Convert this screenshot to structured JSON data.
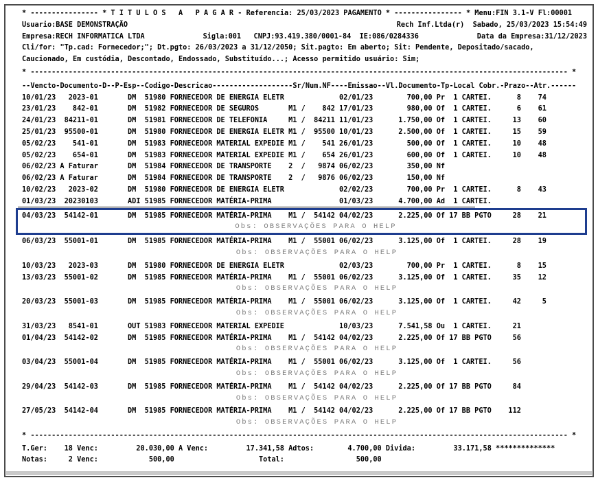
{
  "colors": {
    "selection_box_border": "#1e3d8f",
    "observation_text": "#7d7d7d",
    "window_border": "#4b4b4b",
    "bottom_strip": "#c9c9c9"
  },
  "header": {
    "title_line": "* ---------------- * T I T U L O S   A   P A G A R - Referencia: 25/03/2023 PAGAMENTO * ---------------- * Menu:FIN 3.1-V Fl:00001",
    "usuario": "Usuario:BASE DEMONSTRAÇÃO",
    "vendor_datetime": "Rech Inf.Ltda(r)  Sabado, 25/03/2023 15:54:49",
    "empresa": "Empresa:RECH INFORMATICA LTDA",
    "sigla_cnpj_ie": "Sigla:001   CNPJ:93.419.380/0001-84  IE:086/0284336",
    "data_empresa": "Data da Empresa:31/12/2023",
    "filter_line1": "Cli/for: \"Tp.cad: Fornecedor;\"; Dt.pgto: 26/03/2023 a 31/12/2050; Sit.pagto: Em aberto; Sit: Pendente, Depositado/sacado,",
    "filter_line2": "Caucionado, Em custódia, Descontado, Endossado, Substituído...; Acesso permitido usuário: Sim;"
  },
  "separator_line": "* ------------------------------------------------------------------------------------------------------------------------------- *",
  "columns_header": "--Vencto-Documento-D--P-Esp--Codigo-Descricao-------------------Sr/Num.NF----Emissao--Vl.Documento-Tp-Local Cobr.-Prazo--Atr.------",
  "rows": [
    {
      "vencto": "10/01/23",
      "documento": "2023-01",
      "esp": "DM",
      "codigo": "51980",
      "descricao": "FORNECEDOR DE ENERGIA ELETR",
      "sr": "",
      "num_nf": "",
      "emissao": "02/01/23",
      "valor": "700,00",
      "tp": "Pr",
      "local_num": "1",
      "local_name": "CARTEI.",
      "prazo": "8",
      "atr": "74",
      "obs": "",
      "row_class": ""
    },
    {
      "vencto": "23/01/23",
      "documento": "842-01",
      "esp": "DM",
      "codigo": "51982",
      "descricao": "FORNECEDOR DE SEGUROS",
      "sr": "M1 /",
      "num_nf": "842",
      "emissao": "17/01/23",
      "valor": "980,00",
      "tp": "Of",
      "local_num": "1",
      "local_name": "CARTEI.",
      "prazo": "6",
      "atr": "61",
      "obs": "",
      "row_class": ""
    },
    {
      "vencto": "24/01/23",
      "documento": "84211-01",
      "esp": "DM",
      "codigo": "51981",
      "descricao": "FORNECEDOR DE TELEFONIA",
      "sr": "M1 /",
      "num_nf": "84211",
      "emissao": "11/01/23",
      "valor": "1.750,00",
      "tp": "Of",
      "local_num": "1",
      "local_name": "CARTEI.",
      "prazo": "13",
      "atr": "60",
      "obs": "",
      "row_class": ""
    },
    {
      "vencto": "25/01/23",
      "documento": "95500-01",
      "esp": "DM",
      "codigo": "51980",
      "descricao": "FORNECEDOR DE ENERGIA ELETR",
      "sr": "M1 /",
      "num_nf": "95500",
      "emissao": "10/01/23",
      "valor": "2.500,00",
      "tp": "Of",
      "local_num": "1",
      "local_name": "CARTEI.",
      "prazo": "15",
      "atr": "59",
      "obs": "",
      "row_class": ""
    },
    {
      "vencto": "05/02/23",
      "documento": "541-01",
      "esp": "DM",
      "codigo": "51983",
      "descricao": "FORNECEDOR MATERIAL EXPEDIE",
      "sr": "M1 /",
      "num_nf": "541",
      "emissao": "26/01/23",
      "valor": "500,00",
      "tp": "Of",
      "local_num": "1",
      "local_name": "CARTEI.",
      "prazo": "10",
      "atr": "48",
      "obs": "",
      "row_class": ""
    },
    {
      "vencto": "05/02/23",
      "documento": "654-01",
      "esp": "DM",
      "codigo": "51983",
      "descricao": "FORNECEDOR MATERIAL EXPEDIE",
      "sr": "M1 /",
      "num_nf": "654",
      "emissao": "26/01/23",
      "valor": "600,00",
      "tp": "Of",
      "local_num": "1",
      "local_name": "CARTEI.",
      "prazo": "10",
      "atr": "48",
      "obs": "",
      "row_class": ""
    },
    {
      "vencto": "06/02/23",
      "documento": "A Faturar",
      "esp": "DM",
      "codigo": "51984",
      "descricao": "FORNECEDOR DE TRANSPORTE",
      "sr": "2  /",
      "num_nf": "9874",
      "emissao": "06/02/23",
      "valor": "350,00",
      "tp": "Nf",
      "local_num": "",
      "local_name": "",
      "prazo": "",
      "atr": "",
      "obs": "",
      "row_class": ""
    },
    {
      "vencto": "06/02/23",
      "documento": "A Faturar",
      "esp": "DM",
      "codigo": "51984",
      "descricao": "FORNECEDOR DE TRANSPORTE",
      "sr": "2  /",
      "num_nf": "9876",
      "emissao": "06/02/23",
      "valor": "150,00",
      "tp": "Nf",
      "local_num": "",
      "local_name": "",
      "prazo": "",
      "atr": "",
      "obs": "",
      "row_class": ""
    },
    {
      "vencto": "10/02/23",
      "documento": "2023-02",
      "esp": "DM",
      "codigo": "51980",
      "descricao": "FORNECEDOR DE ENERGIA ELETR",
      "sr": "",
      "num_nf": "",
      "emissao": "02/02/23",
      "valor": "700,00",
      "tp": "Pr",
      "local_num": "1",
      "local_name": "CARTEI.",
      "prazo": "8",
      "atr": "43",
      "obs": "",
      "row_class": ""
    },
    {
      "vencto": "01/03/23",
      "documento": "20230103",
      "esp": "ADI",
      "codigo": "51985",
      "descricao": "FORNECEDOR MATÉRIA-PRIMA",
      "sr": "",
      "num_nf": "",
      "emissao": "01/03/23",
      "valor": "4.700,00",
      "tp": "Ad",
      "local_num": "1",
      "local_name": "CARTEI.",
      "prazo": "",
      "atr": "",
      "obs": "",
      "row_class": "underlined"
    },
    {
      "vencto": "04/03/23",
      "documento": "54142-01",
      "esp": "DM",
      "codigo": "51985",
      "descricao": "FORNECEDOR MATÉRIA-PRIMA",
      "sr": "M1 /",
      "num_nf": "54142",
      "emissao": "04/02/23",
      "valor": "2.225,00",
      "tp": "Of",
      "local_num": "17",
      "local_name": "BB PGTO",
      "prazo": "28",
      "atr": "21",
      "obs": "Obs: OBSERVAÇÕES PARA O HELP",
      "row_class": "selected"
    },
    {
      "vencto": "06/03/23",
      "documento": "55001-01",
      "esp": "DM",
      "codigo": "51985",
      "descricao": "FORNECEDOR MATÉRIA-PRIMA",
      "sr": "M1 /",
      "num_nf": "55001",
      "emissao": "06/02/23",
      "valor": "3.125,00",
      "tp": "Of",
      "local_num": "1",
      "local_name": "CARTEI.",
      "prazo": "28",
      "atr": "19",
      "obs": "Obs: OBSERVAÇÕES PARA O HELP",
      "row_class": ""
    },
    {
      "vencto": "10/03/23",
      "documento": "2023-03",
      "esp": "DM",
      "codigo": "51980",
      "descricao": "FORNECEDOR DE ENERGIA ELETR",
      "sr": "",
      "num_nf": "",
      "emissao": "02/03/23",
      "valor": "700,00",
      "tp": "Pr",
      "local_num": "1",
      "local_name": "CARTEI.",
      "prazo": "8",
      "atr": "15",
      "obs": "",
      "row_class": ""
    },
    {
      "vencto": "13/03/23",
      "documento": "55001-02",
      "esp": "DM",
      "codigo": "51985",
      "descricao": "FORNECEDOR MATÉRIA-PRIMA",
      "sr": "M1 /",
      "num_nf": "55001",
      "emissao": "06/02/23",
      "valor": "3.125,00",
      "tp": "Of",
      "local_num": "1",
      "local_name": "CARTEI.",
      "prazo": "35",
      "atr": "12",
      "obs": "Obs: OBSERVAÇÕES PARA O HELP",
      "row_class": ""
    },
    {
      "vencto": "20/03/23",
      "documento": "55001-03",
      "esp": "DM",
      "codigo": "51985",
      "descricao": "FORNECEDOR MATÉRIA-PRIMA",
      "sr": "M1 /",
      "num_nf": "55001",
      "emissao": "06/02/23",
      "valor": "3.125,00",
      "tp": "Of",
      "local_num": "1",
      "local_name": "CARTEI.",
      "prazo": "42",
      "atr": "5",
      "obs": "Obs: OBSERVAÇÕES PARA O HELP",
      "row_class": ""
    },
    {
      "vencto": "31/03/23",
      "documento": "8541-01",
      "esp": "OUT",
      "codigo": "51983",
      "descricao": "FORNECEDOR MATERIAL EXPEDIE",
      "sr": "",
      "num_nf": "",
      "emissao": "10/03/23",
      "valor": "7.541,58",
      "tp": "Ou",
      "local_num": "1",
      "local_name": "CARTEI.",
      "prazo": "21",
      "atr": "",
      "obs": "",
      "row_class": ""
    },
    {
      "vencto": "01/04/23",
      "documento": "54142-02",
      "esp": "DM",
      "codigo": "51985",
      "descricao": "FORNECEDOR MATÉRIA-PRIMA",
      "sr": "M1 /",
      "num_nf": "54142",
      "emissao": "04/02/23",
      "valor": "2.225,00",
      "tp": "Of",
      "local_num": "17",
      "local_name": "BB PGTO",
      "prazo": "56",
      "atr": "",
      "obs": "Obs: OBSERVAÇÕES PARA O HELP",
      "row_class": ""
    },
    {
      "vencto": "03/04/23",
      "documento": "55001-04",
      "esp": "DM",
      "codigo": "51985",
      "descricao": "FORNECEDOR MATÉRIA-PRIMA",
      "sr": "M1 /",
      "num_nf": "55001",
      "emissao": "06/02/23",
      "valor": "3.125,00",
      "tp": "Of",
      "local_num": "1",
      "local_name": "CARTEI.",
      "prazo": "56",
      "atr": "",
      "obs": "Obs: OBSERVAÇÕES PARA O HELP",
      "row_class": ""
    },
    {
      "vencto": "29/04/23",
      "documento": "54142-03",
      "esp": "DM",
      "codigo": "51985",
      "descricao": "FORNECEDOR MATÉRIA-PRIMA",
      "sr": "M1 /",
      "num_nf": "54142",
      "emissao": "04/02/23",
      "valor": "2.225,00",
      "tp": "Of",
      "local_num": "17",
      "local_name": "BB PGTO",
      "prazo": "84",
      "atr": "",
      "obs": "Obs: OBSERVAÇÕES PARA O HELP",
      "row_class": ""
    },
    {
      "vencto": "27/05/23",
      "documento": "54142-04",
      "esp": "DM",
      "codigo": "51985",
      "descricao": "FORNECEDOR MATÉRIA-PRIMA",
      "sr": "M1 /",
      "num_nf": "54142",
      "emissao": "04/02/23",
      "valor": "2.225,00",
      "tp": "Of",
      "local_num": "17",
      "local_name": "BB PGTO",
      "prazo": "112",
      "atr": "",
      "obs": "Obs: OBSERVAÇÕES PARA O HELP",
      "row_class": ""
    }
  ],
  "footer": {
    "rows": [
      {
        "label_a": "T.Ger:",
        "count": "18",
        "label_b": "Venc:",
        "amount_a": "20.030,00",
        "label_c": "A Venc:",
        "amount_b": "17.341,58",
        "label_d": "Adtos:",
        "amount_c": "4.700,00",
        "label_e": "Divida:",
        "amount_d": "33.171,58",
        "stars": "**************"
      },
      {
        "label_a": "Notas:",
        "count": "2",
        "label_b": "Venc:",
        "amount_a": "500,00",
        "label_c": "",
        "amount_b": "Total:",
        "label_d": "",
        "amount_c": "500,00",
        "label_e": "",
        "amount_d": "",
        "stars": ""
      }
    ]
  }
}
